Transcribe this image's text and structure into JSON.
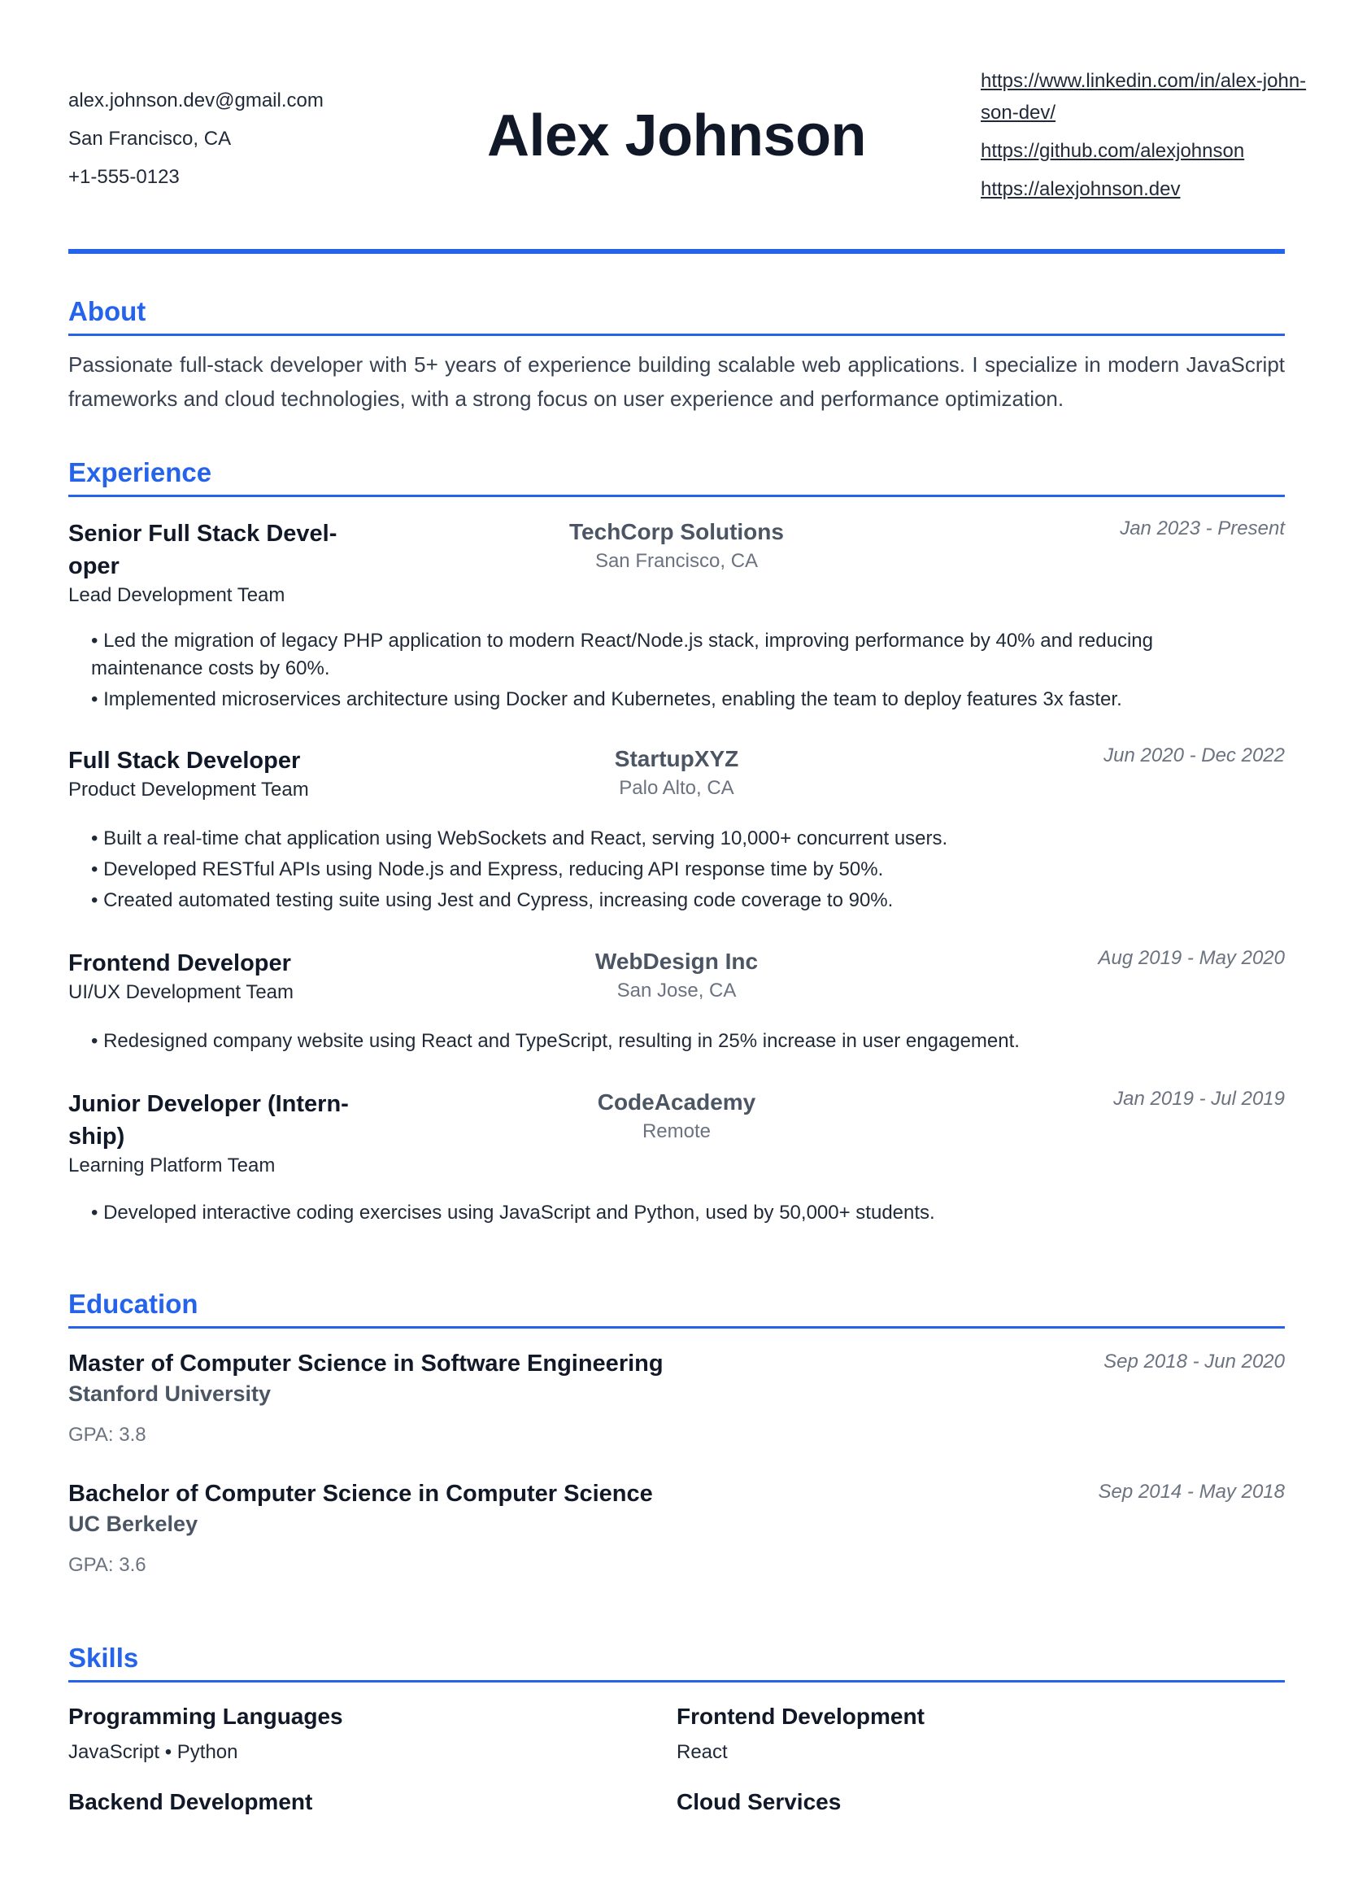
{
  "header": {
    "name": "Alex Johnson",
    "email": "alex.johnson.dev@gmail.com",
    "location": "San Francisco, CA",
    "phone": "+1-555-0123",
    "linkedin": "https://www.linkedin.com/in/alex-john-son-dev/",
    "linkedin_line1": "https://www.linkedin.com/in/alex-john-",
    "linkedin_line2": "son-dev/",
    "github": "https://github.com/alexjohnson",
    "website": "https://alexjohnson.dev"
  },
  "about": {
    "title": "About",
    "text": "Passionate full-stack developer with 5+ years of experience building scalable web applications. I specialize in modern JavaScript frameworks and cloud technologies, with a strong focus on user experience and performance optimization."
  },
  "experience": {
    "title": "Experience",
    "jobs": [
      {
        "title_line1": "Senior Full Stack Devel-",
        "title_line2": "oper",
        "team": "Lead Development Team",
        "company": "TechCorp Solutions",
        "location": "San Francisco, CA",
        "dates": "Jan 2023 - Present",
        "bullets": [
          "• Led the migration of legacy PHP application to modern React/Node.js stack, improving performance by 40% and reducing maintenance costs by 60%.",
          "• Implemented microservices architecture using Docker and Kubernetes, enabling the team to deploy features 3x faster."
        ]
      },
      {
        "title_line1": "Full Stack Developer",
        "team": "Product Development Team",
        "company": "StartupXYZ",
        "location": "Palo Alto, CA",
        "dates": "Jun 2020 - Dec 2022",
        "bullets": [
          "• Built a real-time chat application using WebSockets and React, serving 10,000+ concurrent users.",
          "• Developed RESTful APIs using Node.js and Express, reducing API response time by 50%.",
          "• Created automated testing suite using Jest and Cypress, increasing code coverage to 90%."
        ]
      },
      {
        "title_line1": "Frontend Developer",
        "team": "UI/UX Development Team",
        "company": "WebDesign Inc",
        "location": "San Jose, CA",
        "dates": "Aug 2019 - May 2020",
        "bullets": [
          "• Redesigned company website using React and TypeScript, resulting in 25% increase in user engagement."
        ]
      },
      {
        "title_line1": "Junior Developer (Intern-",
        "title_line2": "ship)",
        "team": "Learning Platform Team",
        "company": "CodeAcademy",
        "location": "Remote",
        "dates": "Jan 2019 - Jul 2019",
        "bullets": [
          "• Developed interactive coding exercises using JavaScript and Python, used by 50,000+ students."
        ]
      }
    ]
  },
  "education": {
    "title": "Education",
    "items": [
      {
        "degree": "Master of Computer Science in Software Engineering",
        "school": "Stanford University",
        "gpa": "GPA: 3.8",
        "dates": "Sep 2018 - Jun 2020"
      },
      {
        "degree": "Bachelor of Computer Science in Computer Science",
        "school": "UC Berkeley",
        "gpa": "GPA: 3.6",
        "dates": "Sep 2014 - May 2018"
      }
    ]
  },
  "skills": {
    "title": "Skills",
    "categories": [
      {
        "name": "Programming Languages",
        "items": "JavaScript • Python"
      },
      {
        "name": "Frontend Development",
        "items": "React"
      },
      {
        "name": "Backend Development",
        "items": ""
      },
      {
        "name": "Cloud Services",
        "items": ""
      }
    ]
  },
  "colors": {
    "accent": "#2563eb",
    "text": "#1f2937",
    "muted": "#6b7280"
  }
}
